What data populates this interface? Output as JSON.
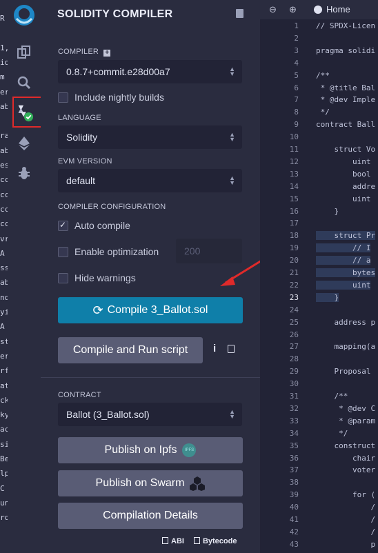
{
  "left_strip_chars": [
    "R",
    "",
    "1,",
    "io",
    "m",
    "er",
    "ab",
    "",
    "ra",
    "ab",
    "es",
    "cc",
    "cc",
    "cc",
    "cc",
    "vr",
    "A",
    "ss",
    "ab",
    "nd",
    "yi",
    "A",
    "st",
    "er",
    "rf",
    "at",
    "ck",
    "ky",
    "ac",
    "si",
    "Be",
    "lp",
    "C",
    "un",
    "ro"
  ],
  "icon_bar": {
    "items": [
      "remix-logo-icon",
      "file-explorer-icon",
      "search-icon",
      "solidity-compiler-icon",
      "deploy-run-icon",
      "debugger-icon"
    ]
  },
  "panel": {
    "title": "SOLIDITY COMPILER",
    "compiler_label": "COMPILER",
    "compiler_version": "0.8.7+commit.e28d00a7",
    "nightly_label": "Include nightly builds",
    "language_label": "LANGUAGE",
    "language_value": "Solidity",
    "evm_label": "EVM VERSION",
    "evm_value": "default",
    "config_label": "COMPILER CONFIGURATION",
    "auto_compile_label": "Auto compile",
    "optimization_label": "Enable optimization",
    "runs_value": "200",
    "hide_warnings_label": "Hide warnings",
    "compile_button": "Compile 3_Ballot.sol",
    "compile_run_button": "Compile and Run script",
    "contract_label": "CONTRACT",
    "contract_value": "Ballot (3_Ballot.sol)",
    "publish_ipfs": "Publish on Ipfs",
    "ipfs_badge": "IPFS",
    "publish_swarm": "Publish on Swarm",
    "compilation_details": "Compilation Details",
    "abi_label": "ABI",
    "bytecode_label": "Bytecode"
  },
  "editor": {
    "home_tab": "Home",
    "current_line": "23",
    "lines": [
      {
        "n": "1",
        "code": "// SPDX-Licen"
      },
      {
        "n": "2",
        "code": ""
      },
      {
        "n": "3",
        "code": "pragma solidi"
      },
      {
        "n": "4",
        "code": ""
      },
      {
        "n": "5",
        "code": "/**"
      },
      {
        "n": "6",
        "code": " * @title Bal"
      },
      {
        "n": "7",
        "code": " * @dev Imple"
      },
      {
        "n": "8",
        "code": " */"
      },
      {
        "n": "9",
        "code": "contract Ball"
      },
      {
        "n": "10",
        "code": ""
      },
      {
        "n": "11",
        "code": "    struct Vo"
      },
      {
        "n": "12",
        "code": "        uint"
      },
      {
        "n": "13",
        "code": "        bool"
      },
      {
        "n": "14",
        "code": "        addre"
      },
      {
        "n": "15",
        "code": "        uint"
      },
      {
        "n": "16",
        "code": "    }"
      },
      {
        "n": "17",
        "code": ""
      },
      {
        "n": "18",
        "code": "    struct Pr"
      },
      {
        "n": "19",
        "code": "        // I"
      },
      {
        "n": "20",
        "code": "        // a"
      },
      {
        "n": "21",
        "code": "        bytes"
      },
      {
        "n": "22",
        "code": "        uint"
      },
      {
        "n": "23",
        "code": "    }"
      },
      {
        "n": "24",
        "code": ""
      },
      {
        "n": "25",
        "code": "    address p"
      },
      {
        "n": "26",
        "code": ""
      },
      {
        "n": "27",
        "code": "    mapping(a"
      },
      {
        "n": "28",
        "code": ""
      },
      {
        "n": "29",
        "code": "    Proposal"
      },
      {
        "n": "30",
        "code": ""
      },
      {
        "n": "31",
        "code": "    /**"
      },
      {
        "n": "32",
        "code": "     * @dev C"
      },
      {
        "n": "33",
        "code": "     * @param"
      },
      {
        "n": "34",
        "code": "     */"
      },
      {
        "n": "35",
        "code": "    construct"
      },
      {
        "n": "36",
        "code": "        chair"
      },
      {
        "n": "37",
        "code": "        voter"
      },
      {
        "n": "38",
        "code": ""
      },
      {
        "n": "39",
        "code": "        for ("
      },
      {
        "n": "40",
        "code": "            /"
      },
      {
        "n": "41",
        "code": "            /"
      },
      {
        "n": "42",
        "code": "            /"
      },
      {
        "n": "43",
        "code": "            p"
      }
    ]
  }
}
